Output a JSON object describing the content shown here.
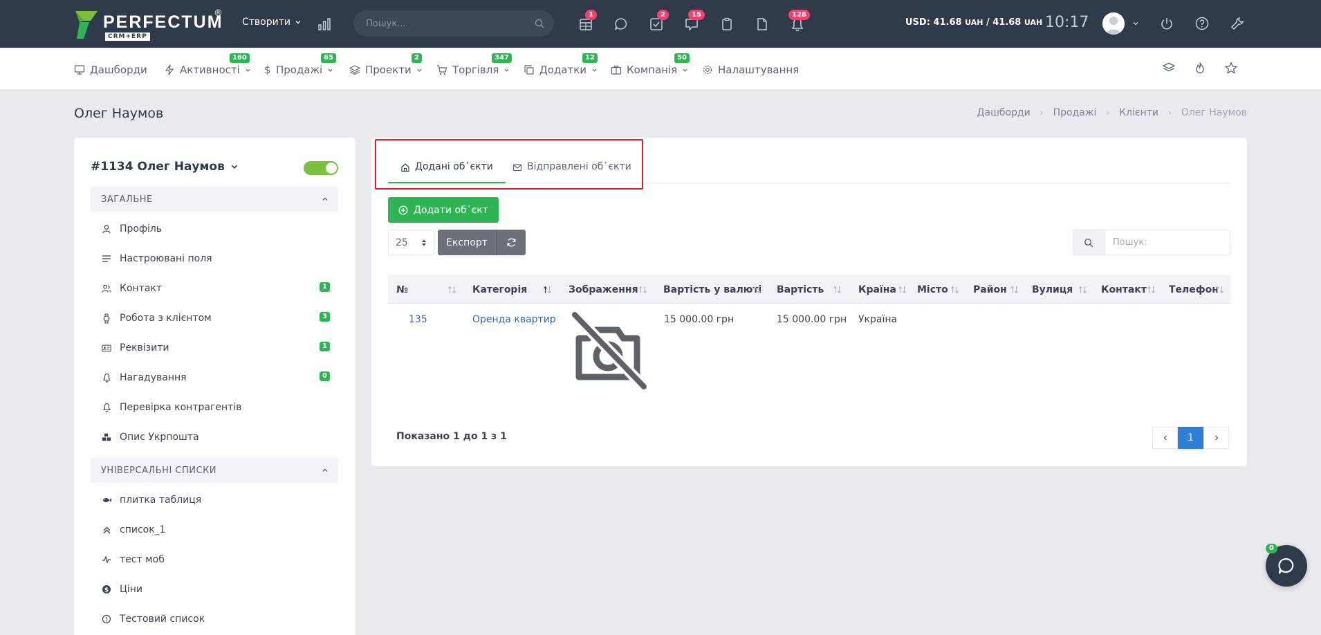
{
  "header": {
    "logo_text": "PERFECTUM",
    "logo_reg": "®",
    "logo_sub": "CRM+ERP",
    "create_label": "Створити",
    "search_placeholder": "Пошук...",
    "badges": {
      "calendar": "1",
      "tasks": "2",
      "messages": "15",
      "notifications": "128"
    },
    "currency_prefix": "USD: 41.68",
    "currency_unit1": "UAH",
    "currency_mid": " / 41.68",
    "currency_unit2": "UAH",
    "time": "10:17"
  },
  "nav": {
    "items": [
      {
        "label": "Дашборди",
        "badge": ""
      },
      {
        "label": "Активності",
        "badge": "160"
      },
      {
        "label": "Продажі",
        "badge": "65"
      },
      {
        "label": "Проекти",
        "badge": "2"
      },
      {
        "label": "Торгівля",
        "badge": "347"
      },
      {
        "label": "Додатки",
        "badge": "12"
      },
      {
        "label": "Компанія",
        "badge": "50"
      },
      {
        "label": "Налаштування",
        "badge": ""
      }
    ]
  },
  "page": {
    "title": "Олег Наумов",
    "breadcrumb": [
      "Дашборди",
      "Продажі",
      "Клієнти",
      "Олег Наумов"
    ]
  },
  "sidebar": {
    "client_title": "#1134 Олег Наумов",
    "section_general": "ЗАГАЛЬНЕ",
    "general_items": [
      {
        "label": "Профіль",
        "count": ""
      },
      {
        "label": "Настроювані поля",
        "count": ""
      },
      {
        "label": "Контакт",
        "count": "1"
      },
      {
        "label": "Робота з клієнтом",
        "count": "3"
      },
      {
        "label": "Реквізити",
        "count": "1"
      },
      {
        "label": "Нагадування",
        "count": "0"
      },
      {
        "label": "Перевірка контрагентів",
        "count": ""
      },
      {
        "label": "Опис Укрпошта",
        "count": ""
      }
    ],
    "section_universal": "УНІВЕРСАЛЬНІ СПИСКИ",
    "universal_items": [
      {
        "label": "плитка таблиця"
      },
      {
        "label": "список_1"
      },
      {
        "label": "тест моб"
      },
      {
        "label": "Ціни"
      },
      {
        "label": "Тестовий список"
      }
    ]
  },
  "main": {
    "tabs": [
      {
        "label": "Додані об᾿єкти",
        "active": true
      },
      {
        "label": "Відправлені об᾿єкти",
        "active": false
      }
    ],
    "add_button": "Додати об᾿єкт",
    "page_size": "25",
    "export_label": "Експорт",
    "search_placeholder": "Пошук:",
    "columns": [
      "№",
      "Категорія",
      "Зображення",
      "Вартість у валюті",
      "Вартість",
      "Країна",
      "Місто",
      "Район",
      "Вулиця",
      "Контакт",
      "Телефон"
    ],
    "rows": [
      {
        "number": "135",
        "category": "Оренда квартир",
        "price_currency": "15 000.00 грн",
        "price": "15 000.00 грн",
        "country": "Україна"
      }
    ],
    "shown_text": "Показано 1 до 1 з 1",
    "current_page": "1"
  },
  "chat": {
    "badge": "0"
  },
  "colors": {
    "accent": "#2fb454",
    "header_bg": "#2f3a4a",
    "highlight": "#e3192a",
    "page_active": "#2f7ed8"
  }
}
